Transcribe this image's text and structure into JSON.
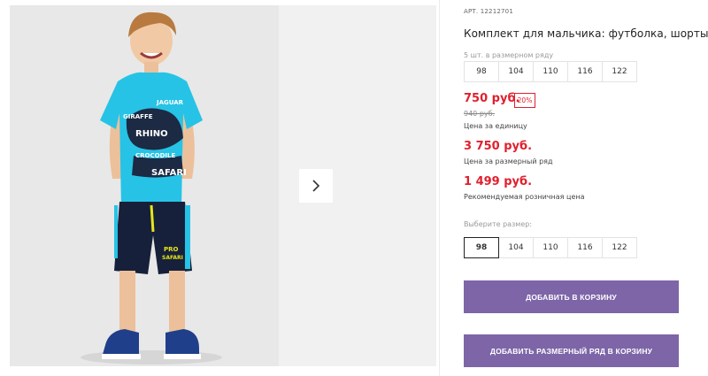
{
  "product": {
    "sku_label": "АРТ.",
    "sku_value": "12212701",
    "title": "Комплект для мальчика: футболка, шорты"
  },
  "size_range": {
    "caption": "5 шт. в размерном ряду",
    "sizes": [
      "98",
      "104",
      "110",
      "116",
      "122"
    ]
  },
  "pricing": {
    "price": "750 руб.",
    "discount_badge": "20%",
    "old_price": "940 руб.",
    "unit_caption": "Цена за единицу",
    "range_price": "3 750 руб.",
    "range_caption": "Цена за размерный ряд",
    "retail_price": "1 499 руб.",
    "retail_caption": "Рекомендуемая розничная цена",
    "accent_color": "#e0202e"
  },
  "size_select": {
    "caption": "Выберите размер:",
    "sizes": [
      "98",
      "104",
      "110",
      "116",
      "122"
    ],
    "selected": "98"
  },
  "actions": {
    "add_to_cart": "ДОБАВИТЬ В КОРЗИНУ",
    "add_range_to_cart": "ДОБАВИТЬ РАЗМЕРНЫЙ РЯД В КОРЗИНУ",
    "button_color": "#7d65a8"
  },
  "gallery": {
    "shirt_text_1": "GIRAFFE",
    "shirt_text_2": "JAGUAR",
    "shirt_text_3": "RHINO",
    "shirt_text_4": "CROCODILE",
    "shirt_text_5": "SAFARI",
    "shorts_text_1": "PRO",
    "shorts_text_2": "SAFARI",
    "next_icon": "chevron-right-icon"
  }
}
